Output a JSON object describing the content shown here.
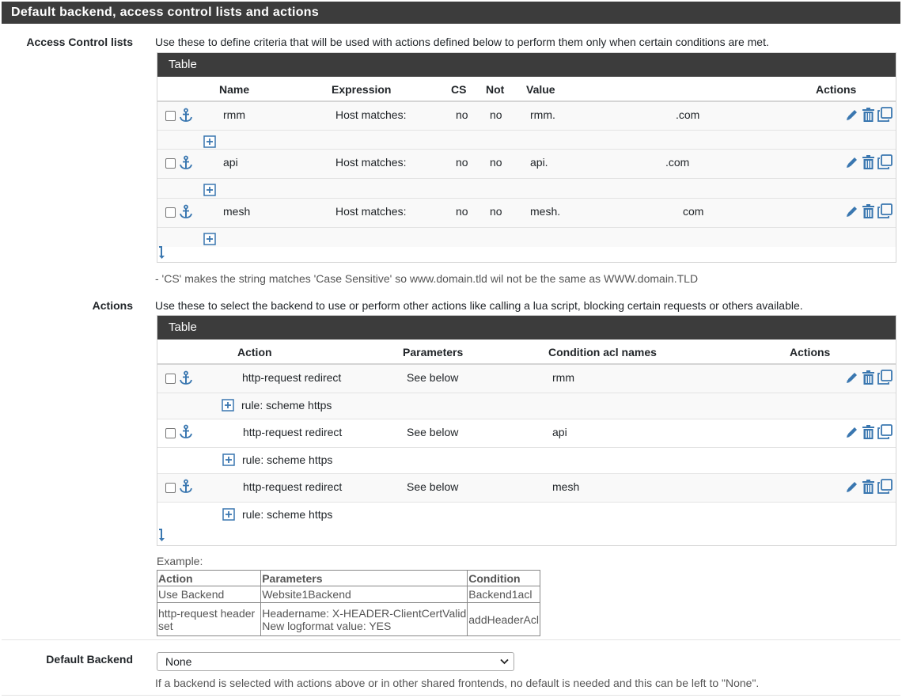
{
  "panel": {
    "title": "Default backend, access control lists and actions"
  },
  "acl": {
    "label": "Access Control lists",
    "description": "Use these to define criteria that will be used with actions defined below to perform them only when certain conditions are met.",
    "table_title": "Table",
    "headers": {
      "name": "Name",
      "expression": "Expression",
      "cs": "CS",
      "not": "Not",
      "value": "Value",
      "actions": "Actions"
    },
    "rows": [
      {
        "name": "rmm",
        "expression": "Host matches:",
        "cs": "no",
        "not": "no",
        "value_a": "rmm.",
        "value_b": ".com"
      },
      {
        "name": "api",
        "expression": "Host matches:",
        "cs": "no",
        "not": "no",
        "value_a": "api.",
        "value_b": ".com"
      },
      {
        "name": "mesh",
        "expression": "Host matches:",
        "cs": "no",
        "not": "no",
        "value_a": "mesh.",
        "value_b": "com"
      }
    ],
    "note": "- 'CS' makes the string matches 'Case Sensitive' so www.domain.tld wil not be the same as WWW.domain.TLD"
  },
  "actions": {
    "label": "Actions",
    "description": "Use these to select the backend to use or perform other actions like calling a lua script, blocking certain requests or others available.",
    "table_title": "Table",
    "headers": {
      "action": "Action",
      "parameters": "Parameters",
      "condition": "Condition acl names",
      "actions": "Actions"
    },
    "rows": [
      {
        "action": "http-request redirect",
        "parameters": "See below",
        "condition": "rmm",
        "sub": "rule: scheme https"
      },
      {
        "action": "http-request redirect",
        "parameters": "See below",
        "condition": "api",
        "sub": "rule: scheme https"
      },
      {
        "action": "http-request redirect",
        "parameters": "See below",
        "condition": "mesh",
        "sub": "rule: scheme https"
      }
    ]
  },
  "example": {
    "label": "Example:",
    "headers": [
      "Action",
      "Parameters",
      "Condition"
    ],
    "row1": [
      "Use Backend",
      "Website1Backend",
      "Backend1acl"
    ],
    "row2": {
      "action": "http-request header set",
      "param_line1": "Headername: X-HEADER-ClientCertValid",
      "param_line2": "New logformat value: YES",
      "condition": "addHeaderAcl"
    }
  },
  "default_backend": {
    "label": "Default Backend",
    "selected": "None",
    "help": "If a backend is selected with actions above or in other shared frontends, no default is needed and this can be left to \"None\"."
  },
  "colors": {
    "accent_blue": "#3a77b0",
    "header_dark": "#3c3c3c"
  },
  "icons": [
    "anchor-icon",
    "plus-icon",
    "pencil-icon",
    "trash-icon",
    "copy-icon",
    "arrow-down-icon",
    "chevron-down-icon"
  ]
}
